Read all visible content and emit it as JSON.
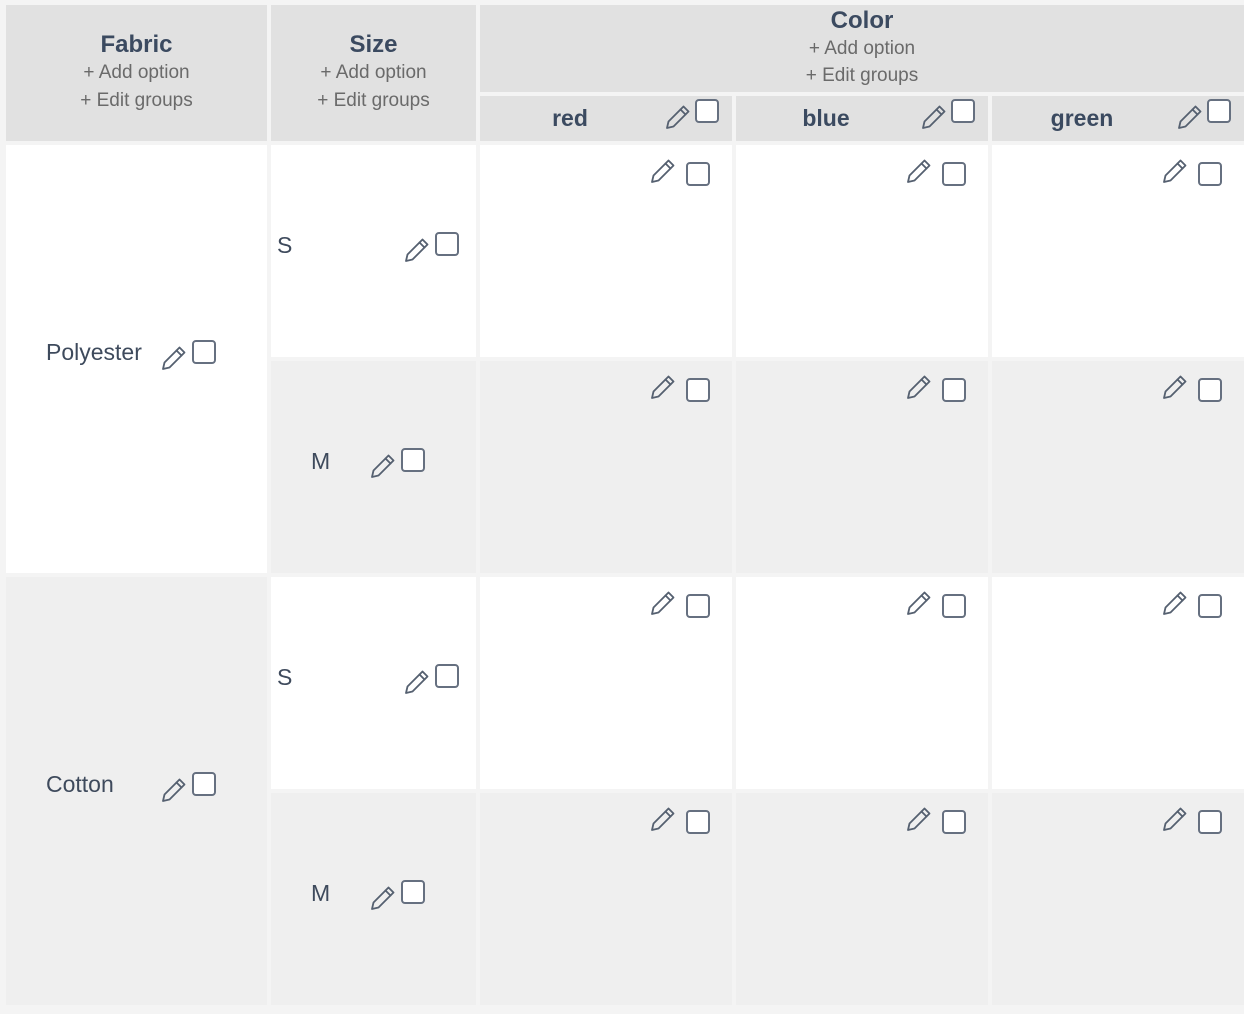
{
  "columns": {
    "fabric": {
      "title": "Fabric",
      "add_option": "+ Add option",
      "edit_groups": "+ Edit groups"
    },
    "size": {
      "title": "Size",
      "add_option": "+ Add option",
      "edit_groups": "+ Edit groups"
    },
    "color": {
      "title": "Color",
      "add_option": "+ Add option",
      "edit_groups": "+ Edit groups",
      "options": [
        "red",
        "blue",
        "green"
      ]
    }
  },
  "rows": [
    {
      "fabric": "Polyester",
      "sizes": [
        "S",
        "M"
      ]
    },
    {
      "fabric": "Cotton",
      "sizes": [
        "S",
        "M"
      ]
    }
  ],
  "icons": {
    "edit": "pencil-icon",
    "select": "checkbox"
  },
  "colors": {
    "header_bg": "#e1e1e1",
    "stripe_bg": "#efefef",
    "text": "#3b4a60",
    "link": "#6a6a6a"
  }
}
